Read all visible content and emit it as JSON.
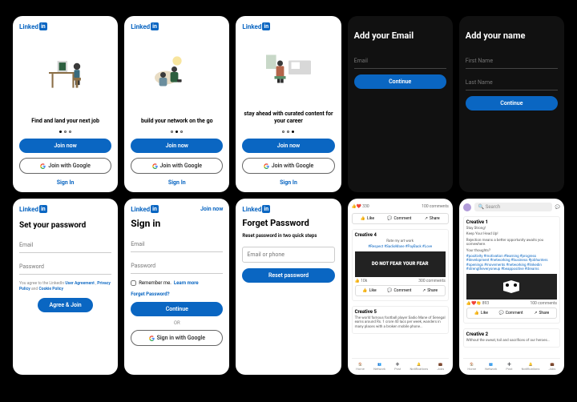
{
  "brand": {
    "name": "Linked",
    "suffix": "in"
  },
  "onboard": [
    {
      "tagline": "Find and land your next job",
      "active_dot": 0
    },
    {
      "tagline": "build your network on the go",
      "active_dot": 1
    },
    {
      "tagline": "stay ahead with curated content for your career",
      "active_dot": 2
    }
  ],
  "buttons": {
    "join_now": "Join now",
    "join_google": "Join with Google",
    "sign_in": "Sign In",
    "continue": "Continue",
    "agree_join": "Agree & Join",
    "signin_google": "Sign in with Google",
    "reset": "Reset password"
  },
  "screens": {
    "email": {
      "title": "Add your Email",
      "ph": "Email"
    },
    "name": {
      "title": "Add your name",
      "first": "First Name",
      "last": "Last Name"
    },
    "pwd": {
      "title": "Set your password",
      "f1": "Email",
      "f2": "Password"
    },
    "signin": {
      "title": "Sign in",
      "f1": "Email",
      "f2": "Password",
      "remember": "Remember me.",
      "learn": "Learn more",
      "forgot": "Forget Password?",
      "or": "OR"
    },
    "forgot": {
      "title": "Forget Password",
      "sub": "Reset password in two quick steps",
      "ph": "Email or phone"
    }
  },
  "legal": {
    "pre": "You agree to the LinkedIn ",
    "ua": "User Agreement",
    "pp": "Privacy Policy",
    "cp": "Cookie Policy",
    "and": " , ",
    "and2": " and "
  },
  "feed": {
    "actions": {
      "like": "Like",
      "comment": "Comment",
      "share": "Share"
    },
    "stats1": {
      "reactions": "330",
      "comments": "100 comments"
    },
    "post4": {
      "name": "Creative 4",
      "pre": "Rate my art work",
      "tags": "#Respect #SadioMane #PayBack #Love",
      "img_text": "DO NOT FEAR\nYOUR FEAR",
      "reactions": "10k",
      "comments": "300 comments"
    },
    "post5": {
      "name": "Creative 5",
      "body": "The world famous football player Sadio Mane of Senegal earns around Rs. 1 crore 40 lacs per week, wanders in many places with a broken mobile phone..."
    },
    "post1": {
      "name": "Creative 1",
      "l1": "Stay Strong!",
      "l2": "Keep Your Head Up!",
      "l3": "Rejection means a better opportunity awaits you somewhere.",
      "l4": "Your thoughts?",
      "tags": "#positivity #motivation #learning #progress #development #networking #business #jobhunters #openings #movements #networking #linkedin #strengtheveryoneup #beappositive #dreams",
      "reactions": "893",
      "comments": "100 comments"
    },
    "post2": {
      "name": "Creative 2",
      "body": "Without the sweat, toil and sacrifices of our heroes..."
    },
    "search": "Search",
    "nav": {
      "home": "Home",
      "net": "Network",
      "post": "Post",
      "notif": "Notifications",
      "jobs": "Jobs"
    }
  }
}
